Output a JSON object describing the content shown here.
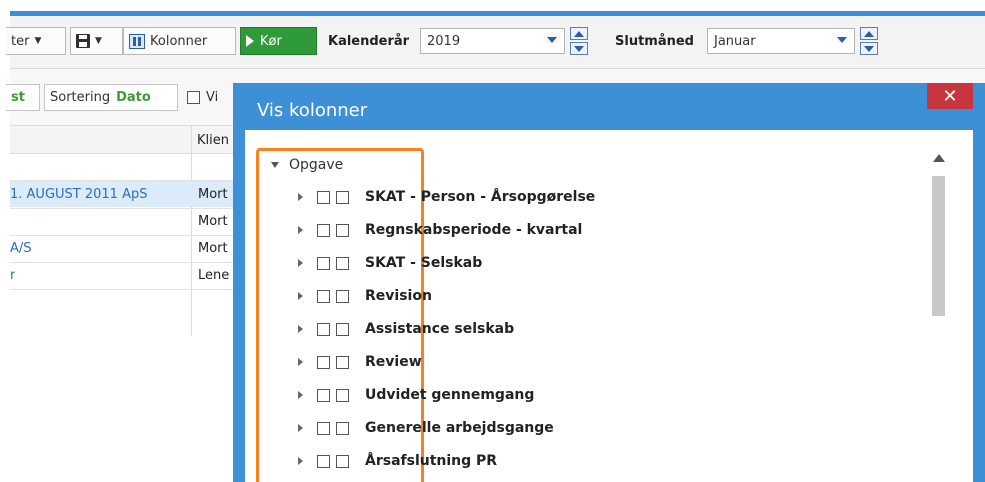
{
  "toolbar": {
    "filter_label": "ter",
    "columns_label": "Kolonner",
    "run_label": "Kør",
    "year_label": "Kalenderår",
    "year_value": "2019",
    "end_month_label": "Slutmåned",
    "end_month_value": "Januar"
  },
  "row2": {
    "btn1_label": "st",
    "sort_label": "Sortering",
    "sort_value": "Dato",
    "vis_label": "Vi"
  },
  "grid": {
    "header_col2": "Klien",
    "rows": [
      {
        "col1": "1. AUGUST 2011 ApS",
        "col2": "Mort"
      },
      {
        "col1": "",
        "col2": "Mort"
      },
      {
        "col1": "A/S",
        "col2": "Mort"
      },
      {
        "col1": "r",
        "col2": "Lene"
      }
    ]
  },
  "dialog": {
    "title": "Vis kolonner",
    "close_glyph": "✕",
    "root_label": "Opgave",
    "items": [
      "SKAT - Person - Årsopgørelse",
      "Regnskabsperiode - kvartal",
      "SKAT - Selskab",
      "Revision",
      "Assistance selskab",
      "Review",
      "Udvidet gennemgang",
      "Generelle arbejdsgange",
      "Årsafslutning PR"
    ]
  },
  "colors": {
    "accent": "#3d90d6",
    "run_green": "#2e9a3a",
    "close_red": "#c7363f",
    "highlight_orange": "#f58220",
    "link_blue": "#2a6ebd"
  }
}
